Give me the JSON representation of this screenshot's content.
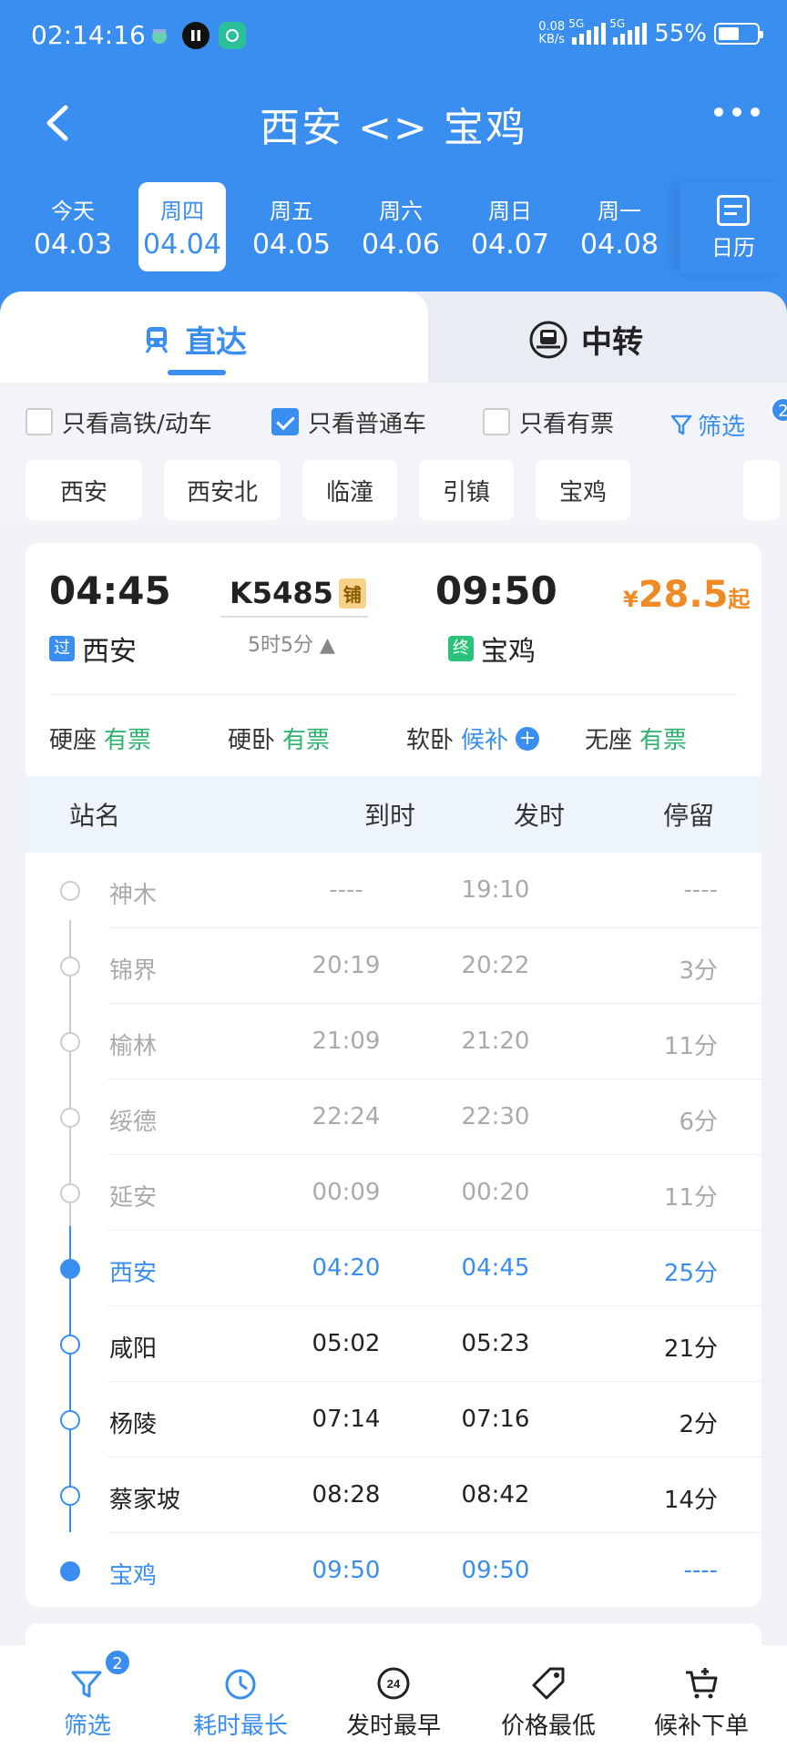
{
  "status_bar": {
    "time": "02:14:16",
    "net_speed_value": "0.08",
    "net_speed_unit": "KB/s",
    "signal1": "5G",
    "signal2": "5G",
    "battery": "55%"
  },
  "header": {
    "title": "西安 <> 宝鸡"
  },
  "dates": [
    {
      "week": "今天",
      "date": "04.03"
    },
    {
      "week": "周四",
      "date": "04.04",
      "selected": true
    },
    {
      "week": "周五",
      "date": "04.05"
    },
    {
      "week": "周六",
      "date": "04.06"
    },
    {
      "week": "周日",
      "date": "04.07"
    },
    {
      "week": "周一",
      "date": "04.08"
    }
  ],
  "calendar_label": "日历",
  "tabs": {
    "direct": "直达",
    "transfer": "中转"
  },
  "filters": {
    "high_speed": "只看高铁/动车",
    "normal": "只看普通车",
    "available": "只看有票",
    "sift": "筛选",
    "sift_count": "2"
  },
  "stations_filter": [
    "西安",
    "西安北",
    "临潼",
    "引镇",
    "宝鸡"
  ],
  "train": {
    "dep_time": "04:45",
    "arr_time": "09:50",
    "number": "K5485",
    "berth_tag": "铺",
    "duration": "5时5分",
    "price_symbol": "¥",
    "price": "28.5",
    "price_suffix": "起",
    "from_tag": "过",
    "from": "西安",
    "to_tag": "终",
    "to": "宝鸡",
    "seats": [
      {
        "type": "硬座",
        "status": "有票"
      },
      {
        "type": "硬卧",
        "status": "有票"
      },
      {
        "type": "软卧",
        "status": "候补"
      },
      {
        "type": "无座",
        "status": "有票"
      }
    ]
  },
  "table": {
    "headers": {
      "name": "站名",
      "arrive": "到时",
      "depart": "发时",
      "stop": "停留"
    },
    "rows": [
      {
        "name": "神木",
        "arrive": "----",
        "depart": "19:10",
        "stop": "----"
      },
      {
        "name": "锦界",
        "arrive": "20:19",
        "depart": "20:22",
        "stop": "3分"
      },
      {
        "name": "榆林",
        "arrive": "21:09",
        "depart": "21:20",
        "stop": "11分"
      },
      {
        "name": "绥德",
        "arrive": "22:24",
        "depart": "22:30",
        "stop": "6分"
      },
      {
        "name": "延安",
        "arrive": "00:09",
        "depart": "00:20",
        "stop": "11分"
      },
      {
        "name": "西安",
        "arrive": "04:20",
        "depart": "04:45",
        "stop": "25分"
      },
      {
        "name": "咸阳",
        "arrive": "05:02",
        "depart": "05:23",
        "stop": "21分"
      },
      {
        "name": "杨陵",
        "arrive": "07:14",
        "depart": "07:16",
        "stop": "2分"
      },
      {
        "name": "蔡家坡",
        "arrive": "08:28",
        "depart": "08:42",
        "stop": "14分"
      },
      {
        "name": "宝鸡",
        "arrive": "09:50",
        "depart": "09:50",
        "stop": "----"
      }
    ]
  },
  "bottom_bar": {
    "filter": "筛选",
    "filter_count": "2",
    "longest": "耗时最长",
    "earliest": "发时最早",
    "cheapest": "价格最低",
    "waitlist": "候补下单",
    "clock_24": "24"
  }
}
